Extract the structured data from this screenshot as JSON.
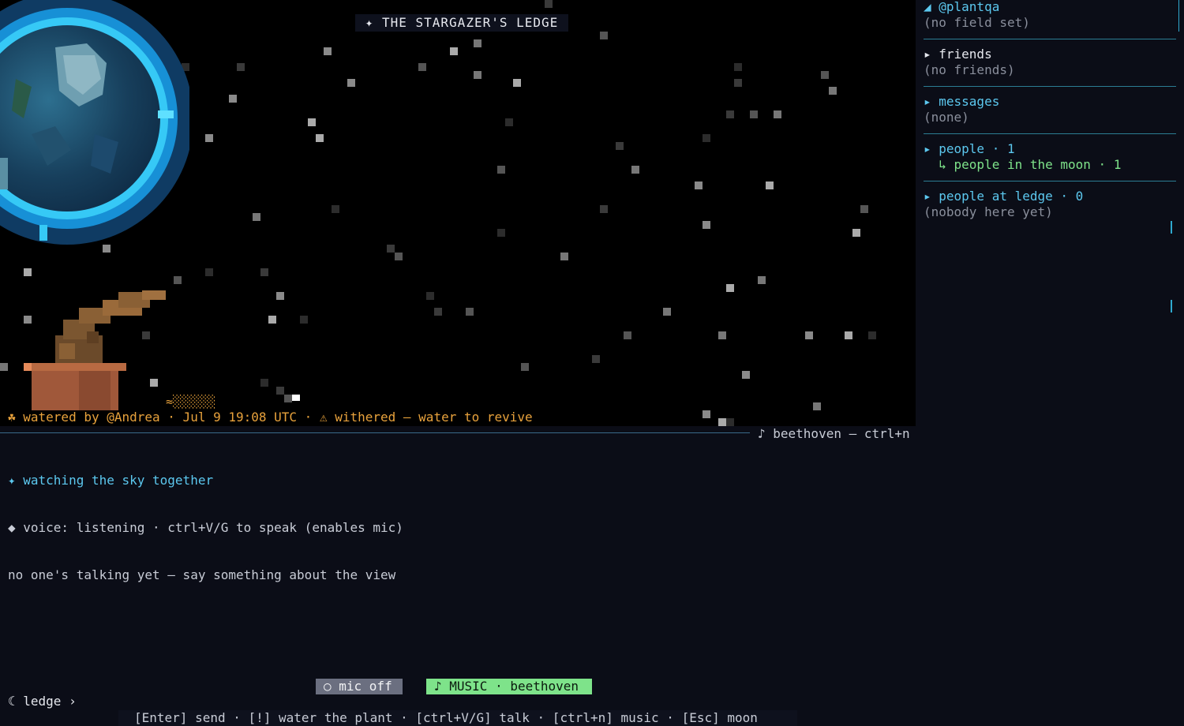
{
  "sky": {
    "title": "✦ THE STARGAZER'S LEDGE",
    "status": "☘ watered by @Andrea · Jul 9 19:08 UTC · ⚠ withered — water to revive",
    "water_wave": "≈░░░░░░"
  },
  "music_hint": "♪ beethoven — ctrl+n",
  "feed": {
    "line1": "✦ watching the sky together",
    "line2": "◆ voice: listening · ctrl+V/G to speak (enables mic)",
    "line3": "no one's talking yet — say something about the view"
  },
  "controls": {
    "mic_label": "○ mic off",
    "music_label": "♪ MUSIC · beethoven"
  },
  "prompt": "☾ ledge ›",
  "help_bar": "[Enter] send · [!] water the plant · [ctrl+V/G] talk · [ctrl+n] music · [Esc] moon",
  "sidebar": {
    "profile": {
      "handle": "◢ @plantqa",
      "field": "(no field set)"
    },
    "friends": {
      "header": "▸ friends",
      "empty": "(no friends)"
    },
    "messages": {
      "header": "▸ messages",
      "empty": "(none)"
    },
    "people": {
      "header": "▸ people · 1",
      "sub": "  ↳ people in the moon · 1"
    },
    "ledge": {
      "header": "▸ people at ledge · 0",
      "empty": "(nobody here yet)"
    }
  },
  "colors": {
    "accent_cyan": "#5cc8ef",
    "status_orange": "#e8a23c",
    "music_green": "#7ee38a",
    "background": "#0b0d17"
  }
}
